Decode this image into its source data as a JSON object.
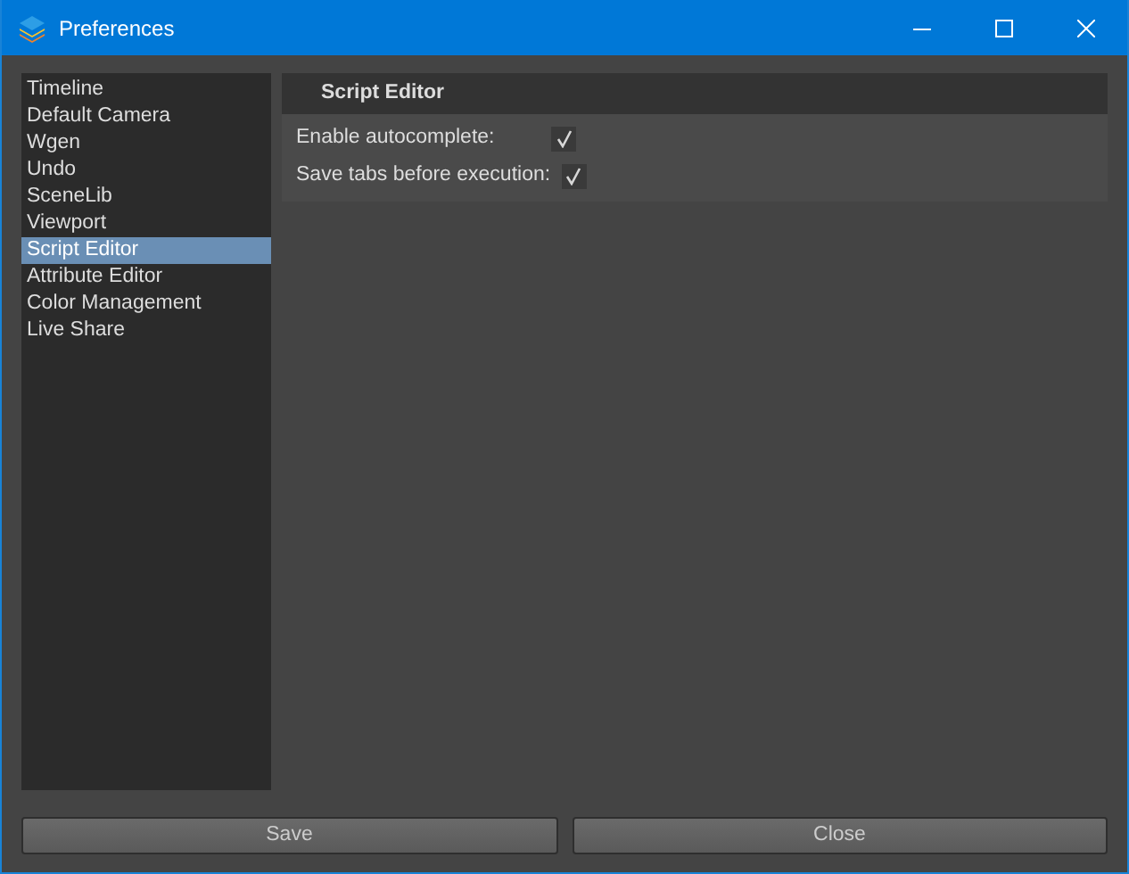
{
  "window": {
    "title": "Preferences"
  },
  "sidebar": {
    "items": [
      {
        "label": "Timeline",
        "selected": false
      },
      {
        "label": "Default Camera",
        "selected": false
      },
      {
        "label": "Wgen",
        "selected": false
      },
      {
        "label": "Undo",
        "selected": false
      },
      {
        "label": "SceneLib",
        "selected": false
      },
      {
        "label": "Viewport",
        "selected": false
      },
      {
        "label": "Script Editor",
        "selected": true
      },
      {
        "label": "Attribute Editor",
        "selected": false
      },
      {
        "label": "Color Management",
        "selected": false
      },
      {
        "label": "Live Share",
        "selected": false
      }
    ]
  },
  "panel": {
    "title": "Script Editor",
    "settings": [
      {
        "label": "Enable autocomplete:",
        "checked": true
      },
      {
        "label": "Save tabs before execution:",
        "checked": true
      }
    ]
  },
  "buttons": [
    "Save",
    "Close"
  ]
}
